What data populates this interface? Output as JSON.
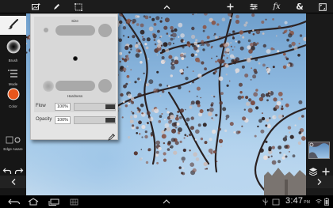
{
  "toolbar": {
    "icons": [
      "image-add-icon",
      "pencil-icon",
      "selection-icon",
      "chevron-up-icon",
      "plus-icon",
      "adjustments-icon",
      "fx-icon",
      "ampersand-icon",
      "fullscreen-icon"
    ],
    "fx_label": "fx",
    "amp_label": "&"
  },
  "left_tools": {
    "brush_label": "Brush",
    "mode_label": "Mode",
    "color_label": "Color",
    "edge_aware_label": "Edge Aware",
    "active_color": "#e8561c"
  },
  "brush_panel": {
    "size_label": "Size",
    "hardness_label": "Hardness",
    "flow_label": "Flow",
    "flow_value": "100%",
    "opacity_label": "Opacity",
    "opacity_value": "100%"
  },
  "status": {
    "clock": "3:47",
    "ampm": "PM"
  }
}
